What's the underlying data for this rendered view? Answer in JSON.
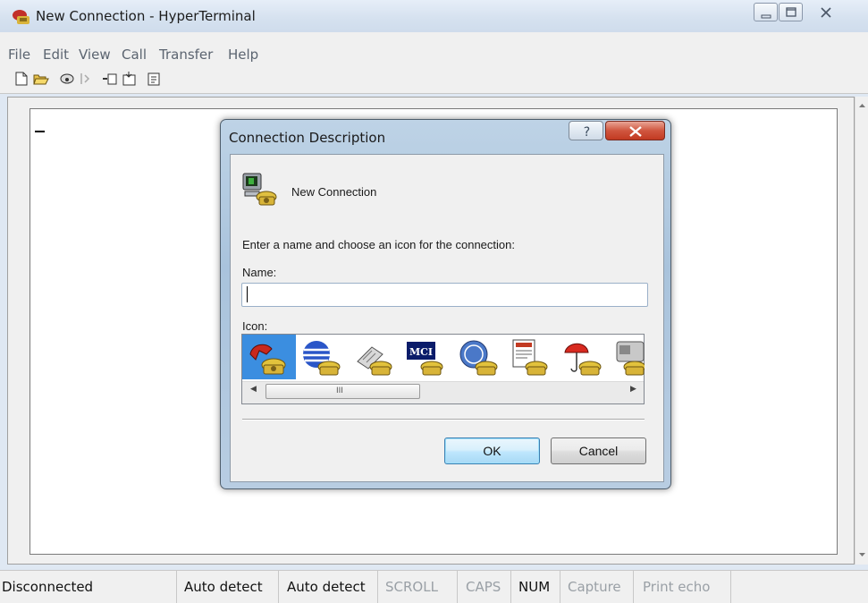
{
  "window": {
    "title": "New Connection - HyperTerminal",
    "icon": "hyperterminal-app-icon",
    "controls": [
      "minimize-icon",
      "maximize-icon",
      "close-icon"
    ]
  },
  "menu": {
    "items": [
      "File",
      "Edit",
      "View",
      "Call",
      "Transfer",
      "Help"
    ]
  },
  "toolbar": {
    "icons": [
      "new-icon",
      "open-icon",
      "call-icon",
      "disconnect-icon",
      "send-icon",
      "receive-icon",
      "properties-icon"
    ]
  },
  "dialog": {
    "title": "Connection Description",
    "help_icon": "help-icon",
    "close_icon": "close-icon",
    "connection_name": "New Connection",
    "prompt": "Enter a name and choose an icon for the connection:",
    "name_label": "Name:",
    "name_value": "",
    "icon_label": "Icon:",
    "icons": [
      "red-phone-icon",
      "globe-phone-icon",
      "fax-phone-icon",
      "mci-phone-icon",
      "ge-phone-icon",
      "document-phone-icon",
      "umbrella-phone-icon",
      "device-phone-icon"
    ],
    "selected_icon": "red-phone-icon",
    "scroll_grip": "III",
    "ok_label": "OK",
    "cancel_label": "Cancel"
  },
  "status": {
    "connection": "Disconnected",
    "detect1": "Auto detect",
    "detect2": "Auto detect",
    "scroll": "SCROLL",
    "caps": "CAPS",
    "num": "NUM",
    "capture": "Capture",
    "print_echo": "Print echo"
  },
  "colors": {
    "dialog_frame": "#a9c3dc",
    "selected_icon_bg": "#3b8ee0",
    "ok_button": "#bee6fd",
    "close_button": "#c23a22"
  }
}
